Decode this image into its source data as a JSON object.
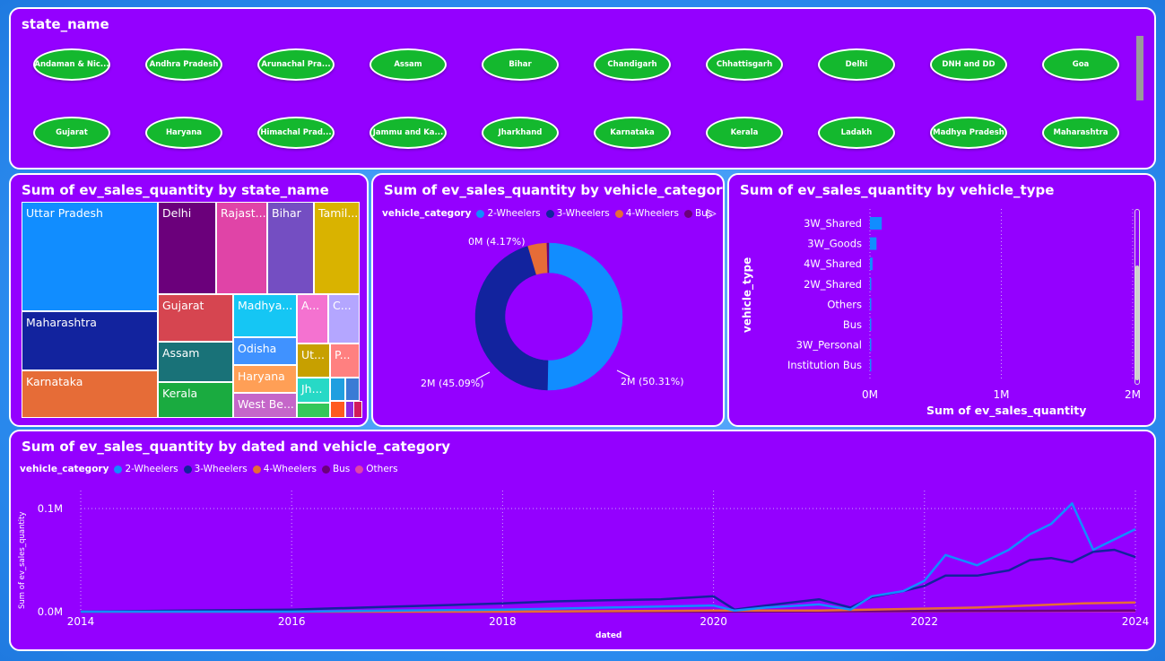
{
  "slicer": {
    "title": "state_name",
    "chips": [
      "Andaman & Nic...",
      "Andhra Pradesh",
      "Arunachal Pra...",
      "Assam",
      "Bihar",
      "Chandigarh",
      "Chhattisgarh",
      "Delhi",
      "DNH and DD",
      "Goa",
      "Gujarat",
      "Haryana",
      "Himachal Prad...",
      "Jammu and Ka...",
      "Jharkhand",
      "Karnataka",
      "Kerala",
      "Ladakh",
      "Madhya Pradesh",
      "Maharashtra"
    ]
  },
  "treemap": {
    "title": "Sum of ev_sales_quantity by state_name",
    "cells": [
      {
        "label": "Uttar Pradesh",
        "color": "#118dff"
      },
      {
        "label": "Maharashtra",
        "color": "#12239e"
      },
      {
        "label": "Karnataka",
        "color": "#e66c37"
      },
      {
        "label": "Delhi",
        "color": "#6b007b"
      },
      {
        "label": "Rajast...",
        "color": "#e044a7"
      },
      {
        "label": "Bihar",
        "color": "#744ec2"
      },
      {
        "label": "Tamil...",
        "color": "#d9b300"
      },
      {
        "label": "Gujarat",
        "color": "#d64550"
      },
      {
        "label": "Assam",
        "color": "#197278"
      },
      {
        "label": "Kerala",
        "color": "#1aab40"
      },
      {
        "label": "Madhya...",
        "color": "#15c6f4"
      },
      {
        "label": "A...",
        "color": "#f472d0"
      },
      {
        "label": "C...",
        "color": "#b4a6ff"
      },
      {
        "label": "Odisha",
        "color": "#4092ff"
      },
      {
        "label": "Haryana",
        "color": "#ff9f56"
      },
      {
        "label": "West Be...",
        "color": "#c566c9"
      },
      {
        "label": "Ut...",
        "color": "#c7a000"
      },
      {
        "label": "P...",
        "color": "#ff8080"
      },
      {
        "label": "Jh...",
        "color": "#27d9c6"
      },
      {
        "label": "",
        "color": "#1f9fe0"
      },
      {
        "label": "",
        "color": "#3a7bd5"
      },
      {
        "label": "",
        "color": "#34c759"
      },
      {
        "label": "",
        "color": "#ff5a1f"
      },
      {
        "label": "",
        "color": "#8a2be2"
      },
      {
        "label": "",
        "color": "#d11a5c"
      }
    ]
  },
  "donut": {
    "title": "Sum of ev_sales_quantity by vehicle_category",
    "legend_title": "vehicle_category",
    "legend": [
      {
        "name": "2-Wheelers",
        "color": "#118dff"
      },
      {
        "name": "3-Wheelers",
        "color": "#12239e"
      },
      {
        "name": "4-Wheelers",
        "color": "#e66c37"
      },
      {
        "name": "Bus",
        "color": "#6b007b"
      }
    ],
    "labels": {
      "two": "2M (50.31%)",
      "three": "2M (45.09%)",
      "four": "0M (4.17%)"
    }
  },
  "vtype": {
    "title": "Sum of ev_sales_quantity by vehicle_type",
    "ylabel": "vehicle_type",
    "xlabel": "Sum of ev_sales_quantity",
    "ticks": [
      "0M",
      "1M",
      "2M"
    ],
    "bar_color": "#118dff"
  },
  "linechart": {
    "title": "Sum of ev_sales_quantity by dated and vehicle_category",
    "legend_title": "vehicle_category",
    "legend": [
      {
        "name": "2-Wheelers",
        "color": "#118dff"
      },
      {
        "name": "3-Wheelers",
        "color": "#12239e"
      },
      {
        "name": "4-Wheelers",
        "color": "#e66c37"
      },
      {
        "name": "Bus",
        "color": "#6b007b"
      },
      {
        "name": "Others",
        "color": "#e044a7"
      }
    ],
    "ylabel": "Sum of ev_sales_quantity",
    "xlabel": "dated",
    "yticks": [
      "0.0M",
      "0.1M"
    ],
    "xticks": [
      "2014",
      "2016",
      "2018",
      "2020",
      "2022",
      "2024"
    ]
  },
  "chart_data": [
    {
      "type": "pie",
      "title": "Sum of ev_sales_quantity by vehicle_category",
      "categories": [
        "2-Wheelers",
        "3-Wheelers",
        "4-Wheelers",
        "Bus"
      ],
      "values": [
        50.31,
        45.09,
        4.17,
        0.43
      ],
      "unit": "%"
    },
    {
      "type": "bar",
      "orientation": "horizontal",
      "title": "Sum of ev_sales_quantity by vehicle_type",
      "categories": [
        "3W_Shared",
        "3W_Goods",
        "4W_Shared",
        "2W_Shared",
        "Others",
        "Bus",
        "3W_Personal",
        "Institution Bus"
      ],
      "values": [
        0.09,
        0.05,
        0.02,
        0.01,
        0.005,
        0.004,
        0.003,
        0.002
      ],
      "unit": "M",
      "xlabel": "Sum of ev_sales_quantity",
      "ylabel": "vehicle_type",
      "xlim": [
        0,
        2
      ]
    },
    {
      "type": "line",
      "title": "Sum of ev_sales_quantity by dated and vehicle_category",
      "xlabel": "dated",
      "ylabel": "Sum of ev_sales_quantity",
      "xlim": [
        2014,
        2024
      ],
      "ylim": [
        0,
        0.1
      ],
      "unit": "M",
      "series": [
        {
          "name": "2-Wheelers",
          "x": [
            2014,
            2015,
            2016,
            2017,
            2018,
            2018.5,
            2019,
            2019.5,
            2020,
            2020.2,
            2020.5,
            2021,
            2021.3,
            2021.5,
            2021.8,
            2022,
            2022.2,
            2022.5,
            2022.8,
            2023,
            2023.2,
            2023.4,
            2023.6,
            2023.8,
            2024
          ],
          "y": [
            0.0,
            0.0,
            0.0,
            0.001,
            0.002,
            0.003,
            0.004,
            0.005,
            0.006,
            0.001,
            0.004,
            0.007,
            0.002,
            0.015,
            0.02,
            0.03,
            0.055,
            0.045,
            0.06,
            0.075,
            0.085,
            0.105,
            0.06,
            0.07,
            0.08
          ]
        },
        {
          "name": "3-Wheelers",
          "x": [
            2014,
            2015,
            2016,
            2017,
            2018,
            2018.5,
            2019,
            2019.5,
            2020,
            2020.2,
            2020.5,
            2021,
            2021.3,
            2021.5,
            2021.8,
            2022,
            2022.2,
            2022.5,
            2022.8,
            2023,
            2023.2,
            2023.4,
            2023.6,
            2023.8,
            2024
          ],
          "y": [
            0.0,
            0.001,
            0.002,
            0.005,
            0.008,
            0.01,
            0.011,
            0.012,
            0.015,
            0.002,
            0.006,
            0.012,
            0.004,
            0.014,
            0.02,
            0.025,
            0.035,
            0.035,
            0.04,
            0.05,
            0.052,
            0.048,
            0.058,
            0.06,
            0.053
          ]
        },
        {
          "name": "4-Wheelers",
          "x": [
            2014,
            2016,
            2018,
            2020,
            2021,
            2022,
            2022.5,
            2023,
            2023.5,
            2024
          ],
          "y": [
            0.0,
            0.0,
            0.0,
            0.001,
            0.001,
            0.003,
            0.004,
            0.006,
            0.008,
            0.009
          ]
        },
        {
          "name": "Bus",
          "x": [
            2014,
            2018,
            2020,
            2022,
            2024
          ],
          "y": [
            0.0,
            0.0,
            0.0,
            0.0005,
            0.001
          ]
        },
        {
          "name": "Others",
          "x": [
            2014,
            2018,
            2020,
            2022,
            2024
          ],
          "y": [
            0.0,
            0.0,
            0.0,
            0.0003,
            0.0005
          ]
        }
      ]
    }
  ]
}
